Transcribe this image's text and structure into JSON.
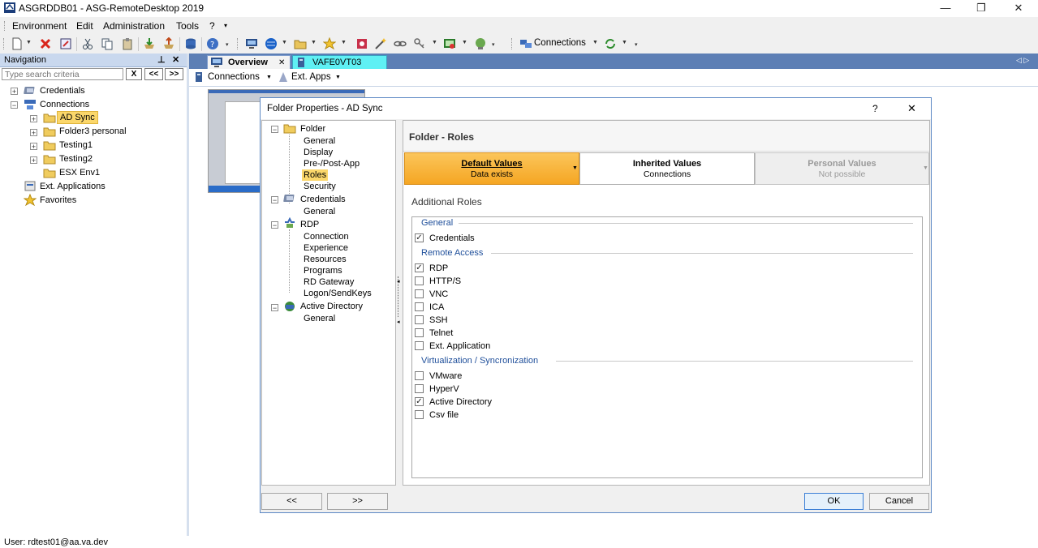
{
  "window": {
    "title": "ASGRDDB01 - ASG-RemoteDesktop 2019",
    "controls": [
      "—",
      "❐",
      "✕"
    ]
  },
  "menu": [
    "Environment",
    "Edit",
    "Administration",
    "Tools",
    "?"
  ],
  "toolbar": {
    "connections_label": "Connections"
  },
  "nav": {
    "title": "Navigation",
    "pin": "⊥",
    "close": "✕",
    "search_placeholder": "Type search criteria",
    "btn_clear": "X",
    "btn_prev": "<<",
    "btn_next": ">>",
    "items": {
      "credentials": "Credentials",
      "connections": "Connections",
      "ad_sync": "AD Sync",
      "folder3": "Folder3 personal",
      "testing1": "Testing1",
      "testing2": "Testing2",
      "esx": "ESX Env1",
      "ext_apps": "Ext. Applications",
      "favorites": "Favorites"
    }
  },
  "tabs": {
    "overview": "Overview",
    "vafe": "VAFE0VT03",
    "close": "✕",
    "scroll": "◁ ▷"
  },
  "subtoolbar": {
    "connections": "Connections",
    "ext_apps": "Ext. Apps"
  },
  "dialog": {
    "title": "Folder Properties - AD Sync",
    "help": "?",
    "close": "✕",
    "tree": {
      "folder": "Folder",
      "general1": "General",
      "display": "Display",
      "prepost": "Pre-/Post-App",
      "roles": "Roles",
      "security": "Security",
      "credentials": "Credentials",
      "general2": "General",
      "rdp": "RDP",
      "connection": "Connection",
      "experience": "Experience",
      "resources": "Resources",
      "programs": "Programs",
      "rdgateway": "RD Gateway",
      "logon": "Logon/SendKeys",
      "ad": "Active Directory",
      "general3": "General"
    },
    "header": "Folder - Roles",
    "values": {
      "default_title": "Default  Values",
      "default_sub": "Data exists",
      "inherited_title": "Inherited  Values",
      "inherited_sub": "Connections",
      "personal_title": "Personal  Values",
      "personal_sub": "Not possible"
    },
    "additional_roles": "Additional Roles",
    "groups": {
      "general": "General",
      "remote": "Remote Access",
      "virt": "Virtualization / Syncronization"
    },
    "checks": {
      "credentials": "Credentials",
      "rdp": "RDP",
      "https": "HTTP/S",
      "vnc": "VNC",
      "ica": "ICA",
      "ssh": "SSH",
      "telnet": "Telnet",
      "extapp": "Ext. Application",
      "vmware": "VMware",
      "hyperv": "HyperV",
      "ad": "Active Directory",
      "csv": "Csv file"
    },
    "checked_mark": "✓",
    "btn_back": "<<",
    "btn_forward": ">>",
    "ok": "OK",
    "cancel": "Cancel"
  },
  "status": {
    "user": "User: rdtest01@aa.va.dev"
  },
  "colors": {
    "accent_orange": "#f9b83f",
    "nav_header": "#c9d8ee",
    "tab_strip": "#5d7fb5",
    "group_text": "#1e4e9a"
  }
}
